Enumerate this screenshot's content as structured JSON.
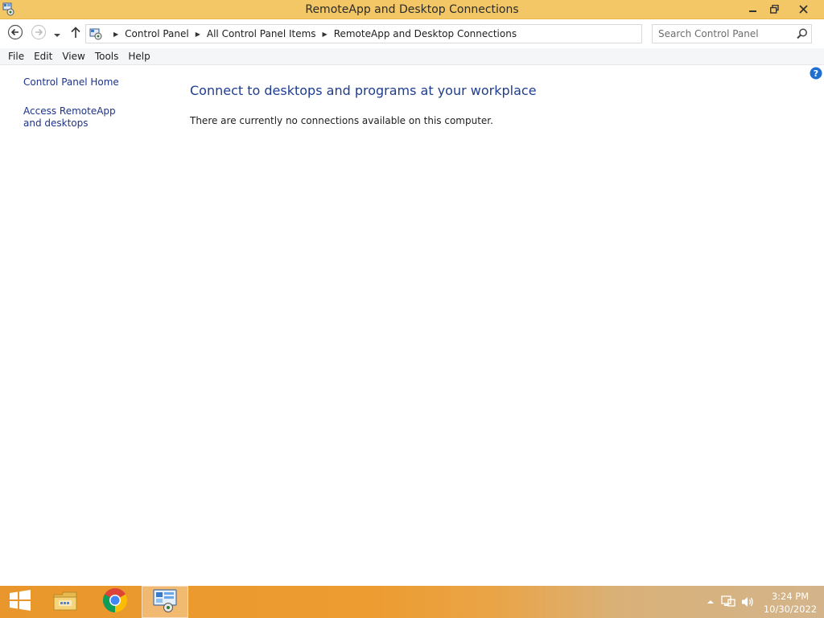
{
  "window": {
    "title": "RemoteApp and Desktop Connections",
    "icon": "control-panel-remoteapp-icon"
  },
  "window_controls": {
    "minimize_icon": "minimize-icon",
    "restore_icon": "restore-icon",
    "close_icon": "close-icon"
  },
  "address_bar": {
    "breadcrumbs": [
      "Control Panel",
      "All Control Panel Items",
      "RemoteApp and Desktop Connections"
    ],
    "search_placeholder": "Search Control Panel"
  },
  "menu": {
    "items": [
      "File",
      "Edit",
      "View",
      "Tools",
      "Help"
    ]
  },
  "sidebar": {
    "links": [
      "Control Panel Home",
      "Access RemoteApp and desktops"
    ]
  },
  "main": {
    "heading": "Connect to desktops and programs at your workplace",
    "message": "There are currently no connections available on this computer."
  },
  "taskbar": {
    "apps": [
      "start-icon",
      "file-explorer-icon",
      "chrome-icon",
      "control-panel-icon"
    ],
    "clock_time": "3:24 PM",
    "clock_date": "10/30/2022"
  },
  "colors": {
    "titlebar": "#f3c766",
    "link": "#1e3287",
    "heading": "#1e3d8f",
    "taskbar": "#ec9c30"
  }
}
